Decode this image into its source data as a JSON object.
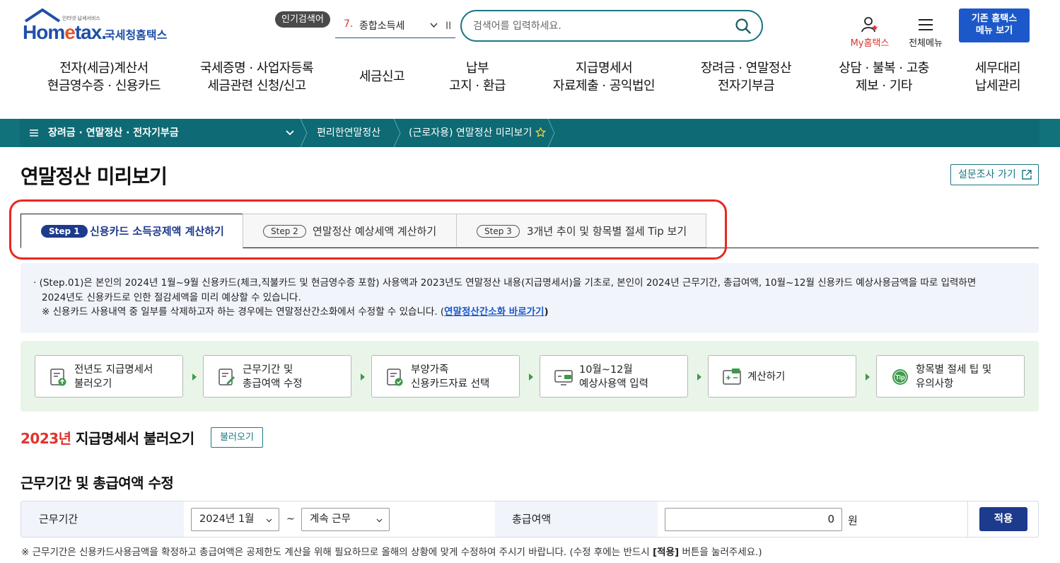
{
  "header": {
    "logo_small": "인터넷 납세서비스",
    "logo_brand_a": "Hom",
    "logo_brand_e": "e",
    "logo_brand_b": "tax.",
    "logo_kr": "국세청홈택스",
    "popular_badge": "인기검색어",
    "popular_num": "7.",
    "popular_keyword": "종합소득세",
    "popular_pause": "II",
    "search_placeholder": "검색어를 입력하세요.",
    "my_home": "My홈택스",
    "all_menu": "전체메뉴",
    "old_home_line1": "기존 홈택스",
    "old_home_line2": "메뉴 보기"
  },
  "gnb": [
    {
      "l1": "전자(세금)계산서",
      "l2": "현금영수증 · 신용카드"
    },
    {
      "l1": "국세증명 · 사업자등록",
      "l2": "세금관련 신청/신고"
    },
    {
      "l1": "세금신고",
      "l2": ""
    },
    {
      "l1": "납부",
      "l2": "고지 · 환급"
    },
    {
      "l1": "지급명세서",
      "l2": "자료제출 · 공익법인"
    },
    {
      "l1": "장려금 · 연말정산",
      "l2": "전자기부금"
    },
    {
      "l1": "상담 · 불복 · 고충",
      "l2": "제보 · 기타"
    },
    {
      "l1": "세무대리",
      "l2": "납세관리"
    }
  ],
  "breadcrumb": {
    "menu": "장려금 · 연말정산 · 전자기부금",
    "level2": "편리한연말정산",
    "level3": "(근로자용) 연말정산 미리보기"
  },
  "page": {
    "title": "연말정산 미리보기",
    "survey": "설문조사 가기"
  },
  "steps": [
    {
      "pill": "Step 1",
      "label": "신용카드 소득공제액 계산하기",
      "active": true
    },
    {
      "pill": "Step 2",
      "label": "연말정산 예상세액 계산하기",
      "active": false
    },
    {
      "pill": "Step 3",
      "label": "3개년 추이 및 항목별 절세 Tip 보기",
      "active": false
    }
  ],
  "info": {
    "line1": "(Step.01)은 본인의 2024년 1월~9월 신용카드(체크,직불카드 및 현금영수증 포함) 사용액과 2023년도 연말정산 내용(지급명세서)을 기초로, 본인이 2024년 근무기간, 총급여액, 10월~12월 신용카드 예상사용금액을 따로 입력하면",
    "line2": "2024년도 신용카드로 인한 절감세액을 미리 예상할 수 있습니다.",
    "line3_pre": "※ 신용카드 사용내역 중 일부를 삭제하고자 하는 경우에는 연말정산간소화에서 수정할 수 있습니다. (",
    "line3_link": "연말정산간소화 바로가기",
    "line3_post": ")"
  },
  "flow": [
    {
      "l1": "전년도 지급명세서",
      "l2": "불러오기",
      "icon": "document-upload-icon"
    },
    {
      "l1": "근무기간 및",
      "l2": "총급여액 수정",
      "icon": "document-edit-icon"
    },
    {
      "l1": "부양가족",
      "l2": "신용카드자료 선택",
      "icon": "document-check-icon"
    },
    {
      "l1": "10월~12월",
      "l2": "예상사용액 입력",
      "icon": "monitor-input-icon"
    },
    {
      "l1": "계산하기",
      "l2": "",
      "icon": "calculator-icon"
    },
    {
      "l1": "항목별 절세 팁 및",
      "l2": "유의사항",
      "icon": "tip-icon"
    }
  ],
  "section1": {
    "year": "2023년",
    "title": " 지급명세서 불러오기",
    "button": "불러오기"
  },
  "section2": {
    "title": "근무기간 및 총급여액 수정",
    "period_label": "근무기간",
    "period_start": "2024년 1월",
    "tilde": "~",
    "period_end": "계속 근무",
    "salary_label": "총급여액",
    "salary_value": "0",
    "won": "원",
    "apply": "적용"
  },
  "note": {
    "pre": "※ 근무기간은 신용카드사용금액을 확정하고 총급여액은 공제한도 계산을 위해 필요하므로 올해의 상황에 맞게 수정하여 주시기 바랍니다. (수정 후에는 반드시 ",
    "bold": "[적용]",
    "post": " 버튼을 눌러주세요.)"
  },
  "colors": {
    "brand_blue": "#1f4fa8",
    "teal": "#0e6a74",
    "red": "#e0332d",
    "navy": "#1d3b8c",
    "green_bg": "#e9f5e9"
  }
}
